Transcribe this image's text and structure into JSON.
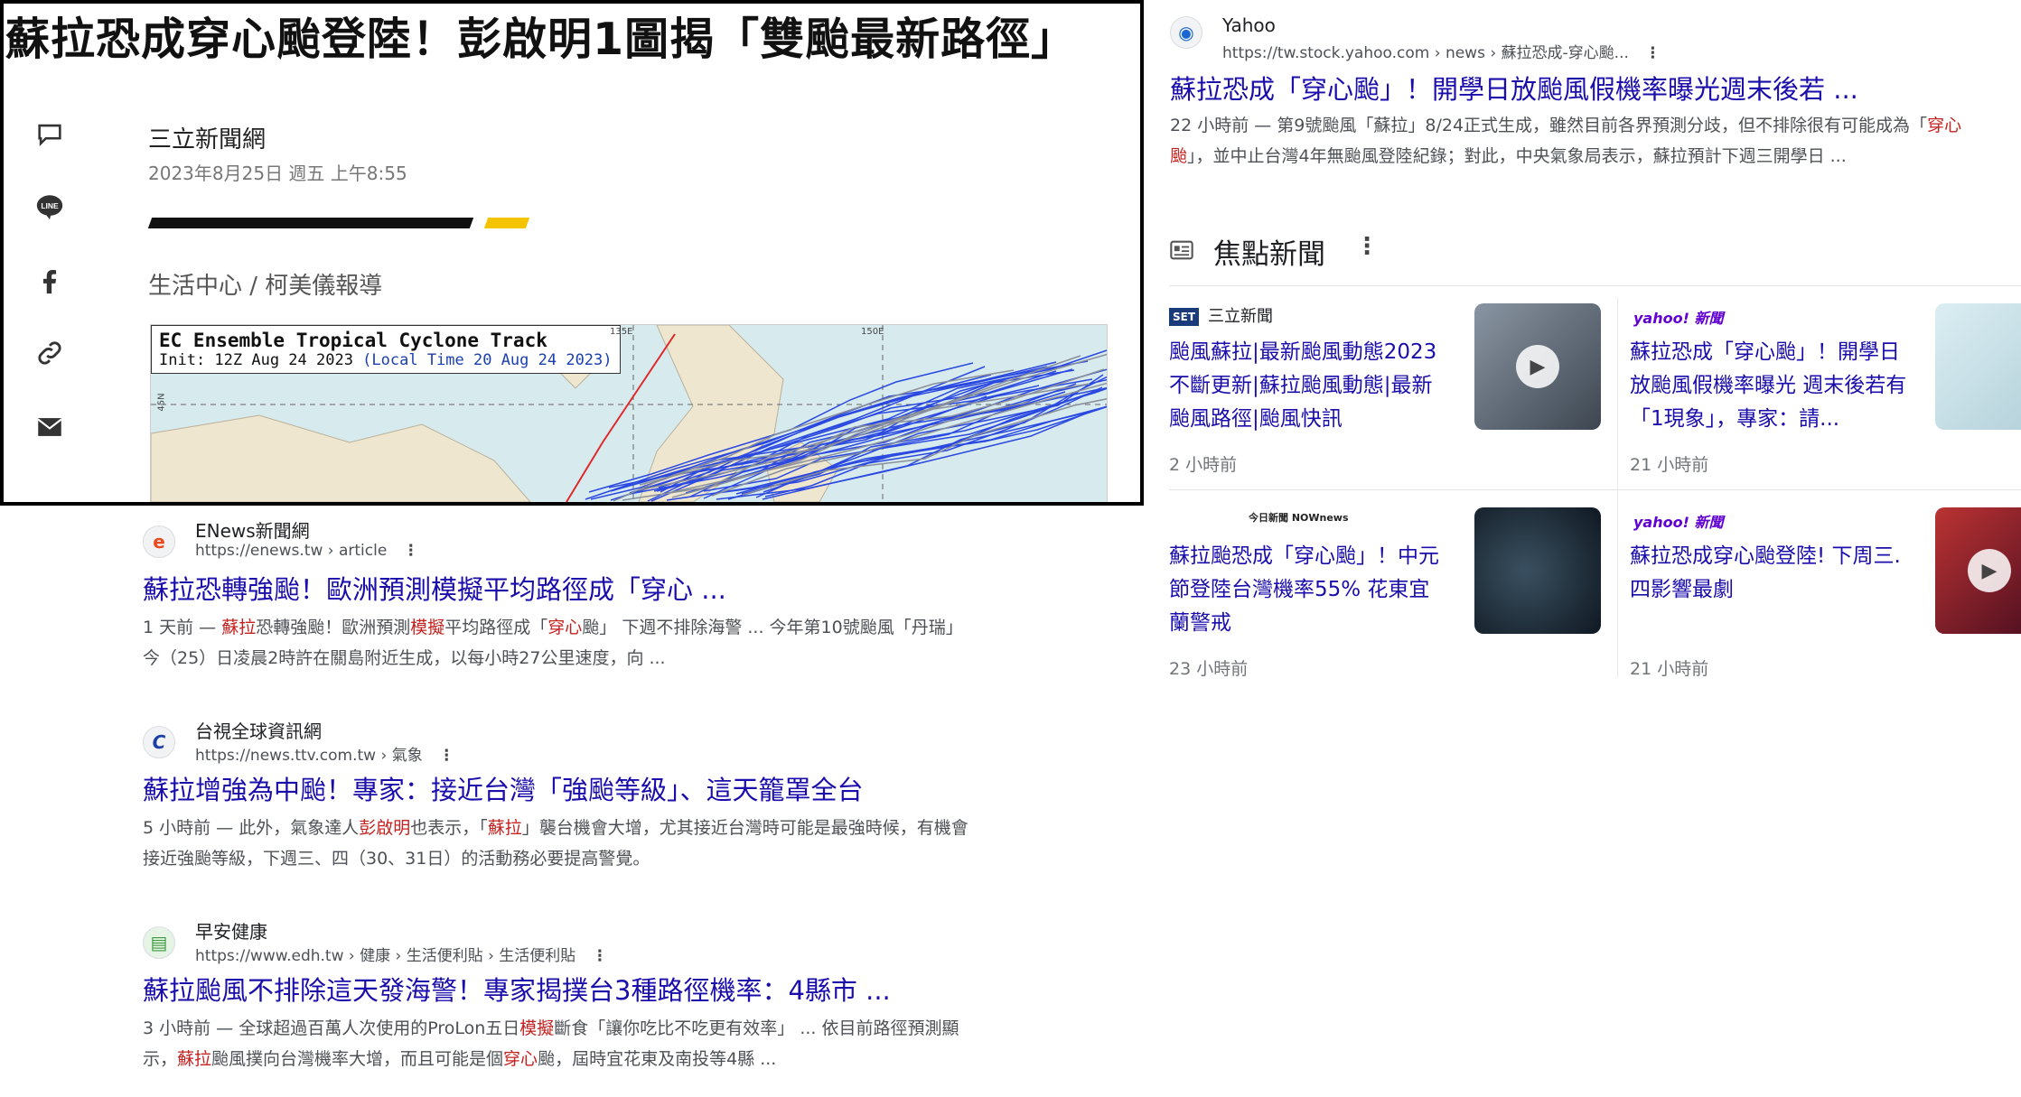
{
  "article": {
    "title": "蘇拉恐成穿心颱登陸！彭啟明1圖揭「雙颱最新路徑」",
    "outlet": "三立新聞網",
    "date": "2023年8月25日 週五 上午8:55",
    "byline": "生活中心 / 柯美儀報導",
    "share_icons": [
      "comment-icon",
      "line-icon",
      "facebook-icon",
      "link-icon",
      "mail-icon"
    ],
    "map": {
      "title": "EC Ensemble Tropical Cyclone Track",
      "init": "Init: 12Z Aug 24 2023 ",
      "local": "(Local Time 20 Aug 24 2023)",
      "lon_labels": [
        "135E",
        "150E"
      ],
      "lat_label": "45N"
    }
  },
  "results": [
    {
      "site": "ENews新聞網",
      "url": "https://enews.tw › article",
      "favicon": "e",
      "favicon_color": "#e8491d",
      "title": "蘇拉恐轉強颱！歐洲預測模擬平均路徑成「穿心 ...",
      "snippet": [
        {
          "t": "1 天前 — "
        },
        {
          "t": "蘇拉",
          "h": true
        },
        {
          "t": "恐轉強颱！歐洲預測"
        },
        {
          "t": "模擬",
          "h": true
        },
        {
          "t": "平均路徑成「"
        },
        {
          "t": "穿心",
          "h": true
        },
        {
          "t": "颱」 下週不排除海警 ... 今年第10號颱風「丹瑞」今（25）日凌晨2時許在關島附近生成，以每小時27公里速度，向 ..."
        }
      ]
    },
    {
      "site": "台視全球資訊網",
      "url": "https://news.ttv.com.tw › 氣象",
      "favicon": "C",
      "favicon_color": "#1b3fa8",
      "title": "蘇拉增強為中颱！專家：接近台灣「強颱等級」、這天籠罩全台",
      "snippet": [
        {
          "t": "5 小時前 — 此外，氣象達人"
        },
        {
          "t": "彭啟明",
          "h": true
        },
        {
          "t": "也表示，「"
        },
        {
          "t": "蘇拉",
          "h": true
        },
        {
          "t": "」襲台機會大增，尤其接近台灣時可能是最強時候，有機會接近強颱等級，下週三、四（30、31日）的活動務必要提高警覺。"
        }
      ]
    },
    {
      "site": "早安健康",
      "url": "https://www.edh.tw › 健康 › 生活便利貼 › 生活便利貼",
      "favicon": "▤",
      "favicon_color": "#3c9a3c",
      "title": "蘇拉颱風不排除這天發海警！專家揭撲台3種路徑機率：4縣市 ...",
      "snippet": [
        {
          "t": "3 小時前 — 全球超過百萬人次使用的ProLon五日"
        },
        {
          "t": "模擬",
          "h": true
        },
        {
          "t": "斷食「讓你吃比不吃更有效率」 ... 依目前路徑預測顯示，"
        },
        {
          "t": "蘇拉",
          "h": true
        },
        {
          "t": "颱風撲向台灣機率大增，而且可能是個"
        },
        {
          "t": "穿心",
          "h": true
        },
        {
          "t": "颱，屆時宜花東及南投等4縣 ..."
        }
      ]
    }
  ],
  "yahoo": {
    "site": "Yahoo",
    "url": "https://tw.stock.yahoo.com › news › 蘇拉恐成-穿心颱...",
    "favicon": "◉",
    "favicon_color": "#1a66d2",
    "title": "蘇拉恐成「穿心颱」！開學日放颱風假機率曝光週末後若 ...",
    "snippet": [
      {
        "t": "22 小時前 — 第9號颱風「蘇拉」8/24正式生成，雖然目前各界預測分歧，但不排除很有可能成為「"
      },
      {
        "t": "穿心颱",
        "h": true
      },
      {
        "t": "」，並中止台灣4年無颱風登陸紀錄；對此，中央氣象局表示，蘇拉預計下週三開學日 ..."
      }
    ]
  },
  "focus": {
    "heading": "焦點新聞",
    "cards": [
      {
        "source": "三立新聞",
        "logo": "SET",
        "logo_color": "#1b3a7a",
        "title": "颱風蘇拉|最新颱風動態2023不斷更新|蘇拉颱風動態|最新颱風路徑|颱風快訊",
        "time": "2 小時前",
        "video": true,
        "thumb_color": "#6a7480"
      },
      {
        "source": "",
        "logo": "yahoo! 新聞",
        "logo_color": "#6001d2",
        "title": "蘇拉恐成「穿心颱」！開學日放颱風假機率曝光 週末後若有「1現象」，專家：請...",
        "time": "21 小時前",
        "video": false,
        "thumb_color": "#cfe3ea"
      },
      {
        "source": "",
        "logo": "今日新聞 NOWnews",
        "logo_color": "#222222",
        "title": "蘇拉颱恐成「穿心颱」！中元節登陸台灣機率55% 花東宜蘭警戒",
        "time": "23 小時前",
        "video": false,
        "thumb_color": "#1b2a3a"
      },
      {
        "source": "",
        "logo": "yahoo! 新聞",
        "logo_color": "#6001d2",
        "title": "蘇拉恐成穿心颱登陸! 下周三.四影響最劇",
        "time": "21 小時前",
        "video": true,
        "thumb_color": "#8a2a2a"
      }
    ]
  }
}
